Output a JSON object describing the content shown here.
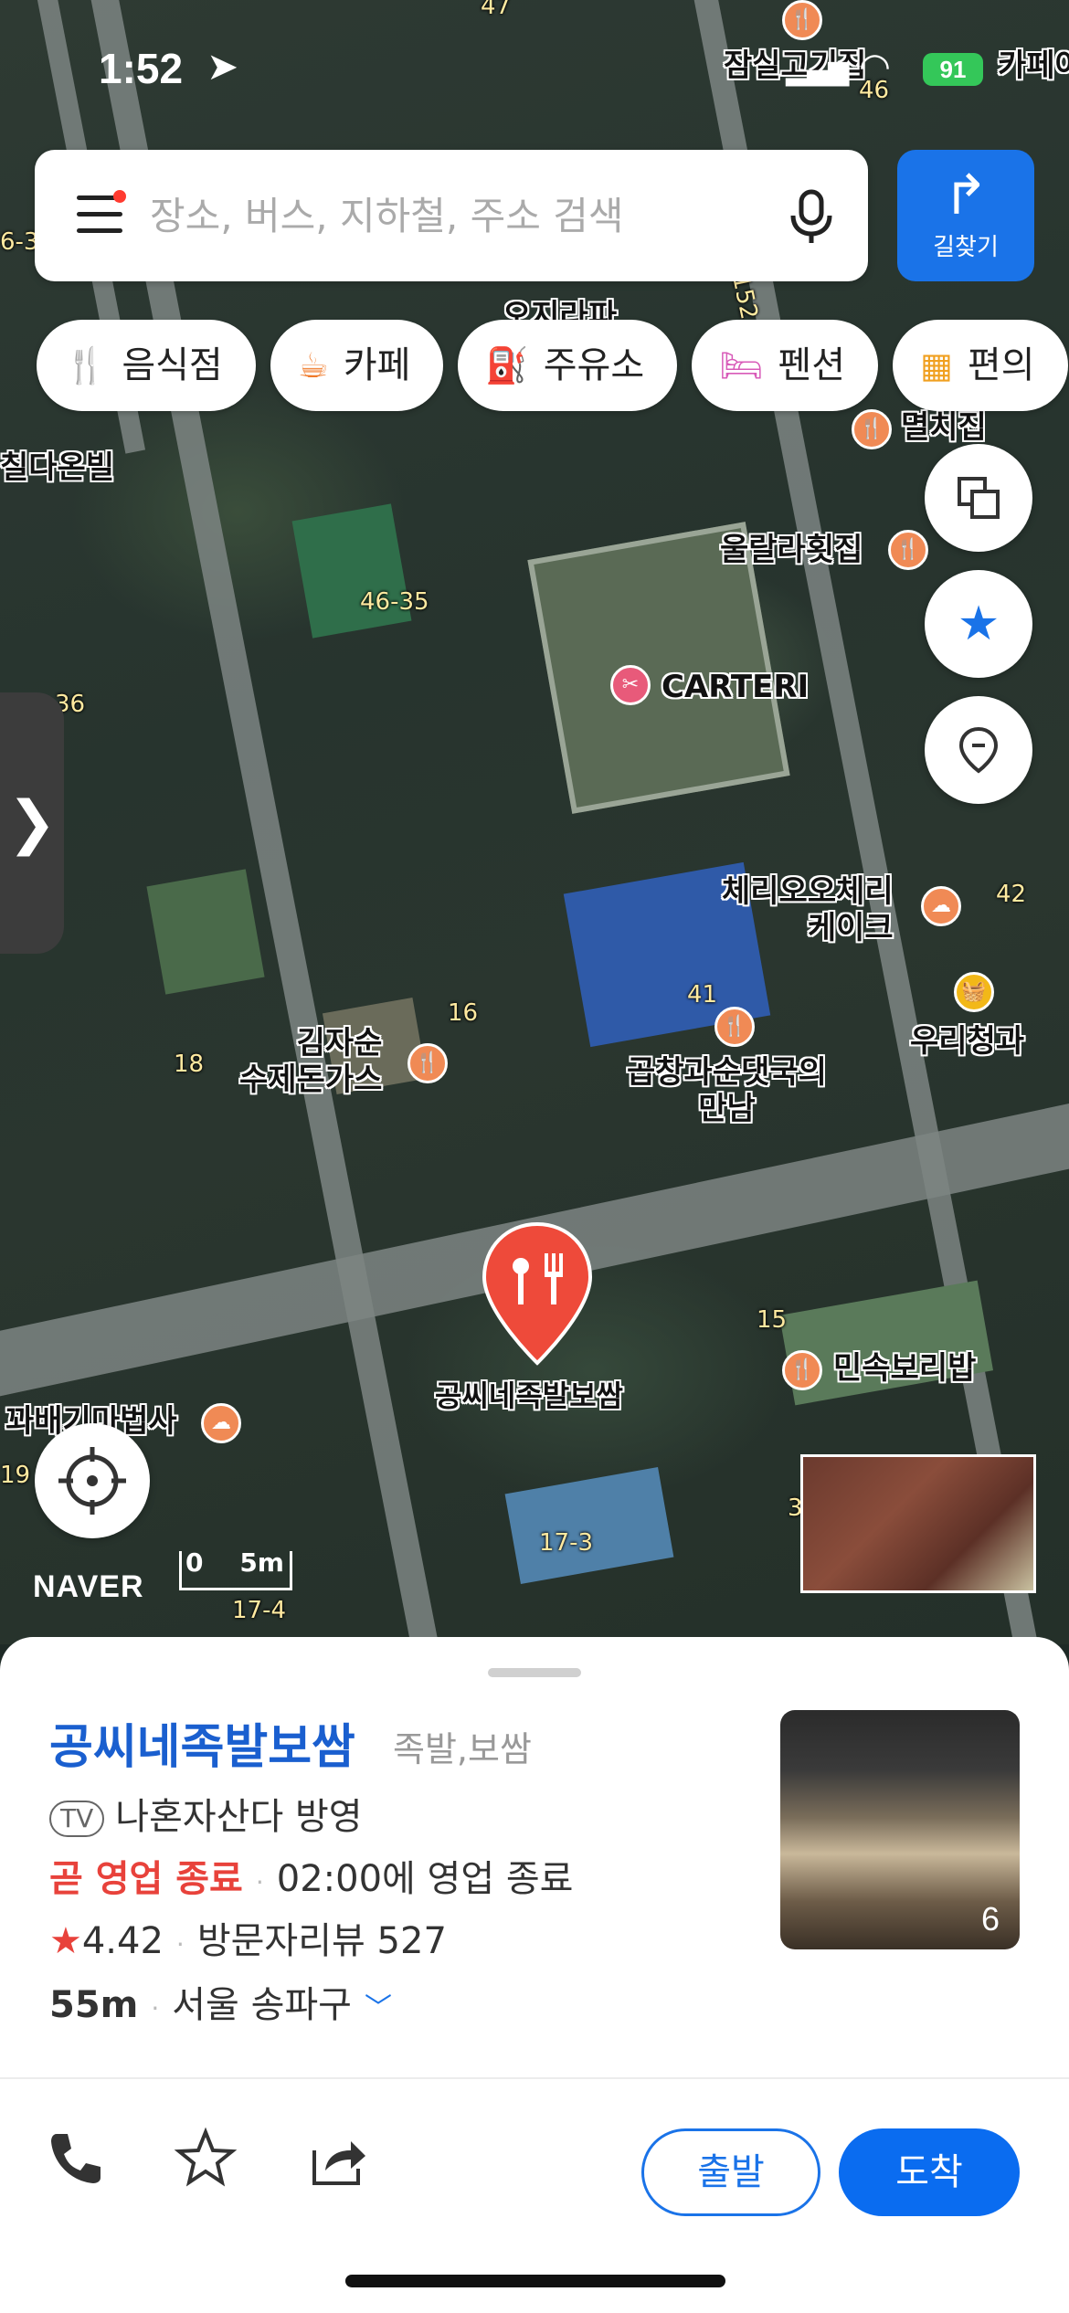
{
  "status_bar": {
    "time": "1:52",
    "battery": "91"
  },
  "search": {
    "placeholder": "장소, 버스, 지하철, 주소 검색"
  },
  "route_button": {
    "label": "길찾기"
  },
  "categories": [
    {
      "label": "음식점",
      "icon": "fork-knife-icon",
      "color": "#f08a3a"
    },
    {
      "label": "카페",
      "icon": "coffee-icon",
      "color": "#f07a2a"
    },
    {
      "label": "주유소",
      "icon": "fuel-icon",
      "color": "#3a7be0"
    },
    {
      "label": "펜션",
      "icon": "bed-icon",
      "color": "#d85ab8"
    },
    {
      "label": "편의",
      "icon": "store-icon",
      "color": "#f0a020"
    }
  ],
  "map": {
    "places": [
      {
        "name": "잠실고기집"
      },
      {
        "name": "카페어"
      },
      {
        "name": "오지라파"
      },
      {
        "name": "멸치집"
      },
      {
        "name": "칠다온빌"
      },
      {
        "name": "울랄라횟집"
      },
      {
        "name": "CARTERI"
      },
      {
        "name": "체리오오체리\n케이크"
      },
      {
        "name": "우리청과"
      },
      {
        "name": "김자순\n수제돈가스"
      },
      {
        "name": "곱창과순댓국의\n만남"
      },
      {
        "name": "공씨네족발보쌈"
      },
      {
        "name": "민속보리밥"
      },
      {
        "name": "꽈배기마법사"
      }
    ],
    "addresses": [
      "47",
      "46",
      "6-3",
      "46-35",
      "36",
      "42",
      "16",
      "18",
      "41",
      "15",
      "19",
      "17-3",
      "17-4",
      "152",
      "3"
    ],
    "brand": "NAVER",
    "scale": {
      "left": "0",
      "right": "5m"
    }
  },
  "place": {
    "name": "공씨네족발보쌈",
    "category": "족발,보쌈",
    "tv_badge": "TV",
    "tv_show": "나혼자산다 방영",
    "status": "곧 영업 종료",
    "hours": "02:00에 영업 종료",
    "rating": "4.42",
    "review_label": "방문자리뷰 527",
    "distance": "55m",
    "location": "서울 송파구",
    "photo_count": "6"
  },
  "actions": {
    "start": "출발",
    "arrive": "도착"
  },
  "colors": {
    "accent": "#1a73e8",
    "closing": "#e8423b",
    "poi": "#f08a55"
  }
}
